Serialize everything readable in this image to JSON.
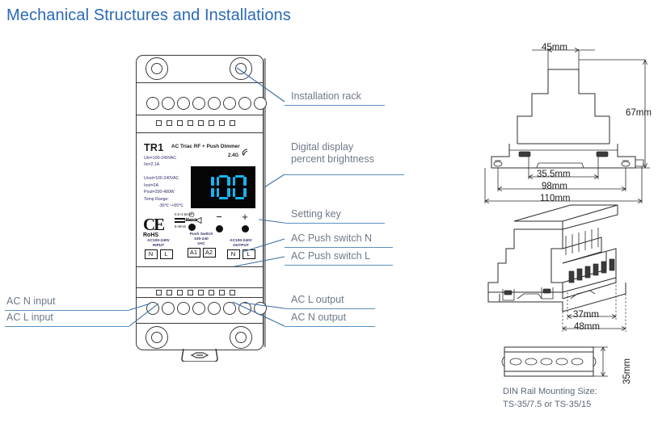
{
  "page": {
    "title": "Mechanical Structures and Installations",
    "title_color": "#2a6ab5"
  },
  "device": {
    "model": "TR1",
    "model_subtitle": "AC Triac RF + Push Dimmer",
    "rf_label": "2.4G",
    "rf_icon": "wireless-signal-icon",
    "specs": [
      "Uin=100-240VAC",
      "Iin=2.1A",
      "Uout=100-240VAC",
      "Iout=2A",
      "Pout=200-480W",
      "Temp Range:",
      "-30℃~+55℃"
    ],
    "display": {
      "value": "100",
      "digit_color": "#17b4ef",
      "background": "#050505"
    },
    "certifications": {
      "ce": "CE",
      "rohs": "RoHS",
      "wire_gauge_top": "0.5~2.5mm²",
      "wire_gauge_bottom": "6~8mm"
    },
    "buttons": [
      {
        "name": "match-power-button",
        "symbol": "⏻",
        "caption": "Match"
      },
      {
        "name": "minus-button",
        "symbol": "−",
        "caption": ""
      },
      {
        "name": "plus-button",
        "symbol": "+",
        "caption": ""
      }
    ],
    "terminals": [
      {
        "name": "ac-input-terminal",
        "title_lines": [
          "AC100-240V",
          "INPUT"
        ],
        "pins": [
          "N",
          "L"
        ]
      },
      {
        "name": "push-switch-terminal",
        "title_lines": [
          "Push Switch",
          "100-240",
          "VAC"
        ],
        "pins": [
          "A1",
          "A2"
        ]
      },
      {
        "name": "ac-output-terminal",
        "title_lines": [
          "AC100-240V",
          "OUTPUT"
        ],
        "pins": [
          "N",
          "L"
        ]
      }
    ],
    "port_count": 8,
    "square_count": 8,
    "screw_count": 4
  },
  "callouts": {
    "right": [
      {
        "name": "callout-installation-rack",
        "label": "Installation rack"
      },
      {
        "name": "callout-digital-display",
        "label": "Digital display"
      },
      {
        "name": "callout-digital-display-2",
        "label": "percent brightness"
      },
      {
        "name": "callout-setting-key",
        "label": "Setting key"
      },
      {
        "name": "callout-ac-push-switch-n",
        "label": "AC Push switch N"
      },
      {
        "name": "callout-ac-push-switch-l",
        "label": "AC Push switch L"
      },
      {
        "name": "callout-ac-l-output",
        "label": "AC L output"
      },
      {
        "name": "callout-ac-n-output",
        "label": "AC N output"
      }
    ],
    "left": [
      {
        "name": "callout-ac-n-input",
        "label": "AC N input"
      },
      {
        "name": "callout-ac-l-input",
        "label": "AC L input"
      }
    ]
  },
  "dimensions": {
    "front_view": {
      "width_top": "45mm",
      "height": "67mm",
      "rail_slot": "35.5mm",
      "body_width": "98mm",
      "total_width": "110mm"
    },
    "iso_view": {
      "depth_inner": "37mm",
      "depth_outer": "48mm"
    },
    "din_rail": {
      "height": "35mm",
      "caption_line1": "DIN Rail Mounting Size:",
      "caption_line2": "TS-35/7.5 or TS-35/15"
    }
  }
}
